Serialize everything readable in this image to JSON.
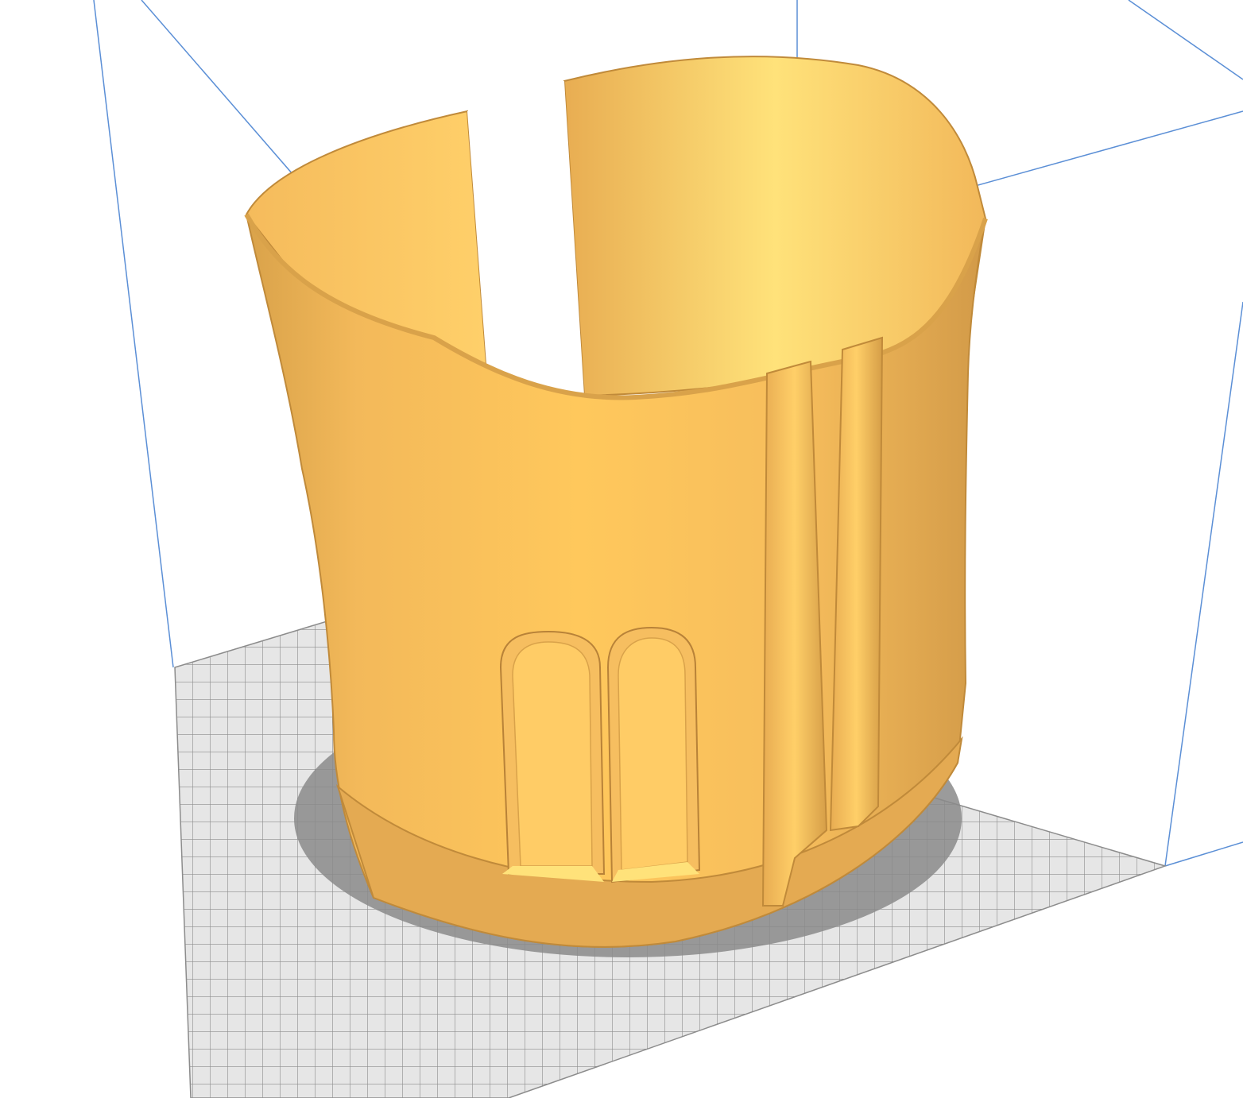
{
  "viewport": {
    "background_color": "#ffffff",
    "build_volume_line_color": "#5b8fd6"
  },
  "build_plate": {
    "grid_fill": "#e6e6e6",
    "grid_line_color": "#8c8c8c",
    "shadow_color": "#8a8a8a"
  },
  "model": {
    "shape": "split cylindrical cuff",
    "base_color": "#ffc85c",
    "highlight_color": "#ffe27a",
    "shade_color": "#d9a24a",
    "dark_shade_color": "#c08a3a"
  }
}
